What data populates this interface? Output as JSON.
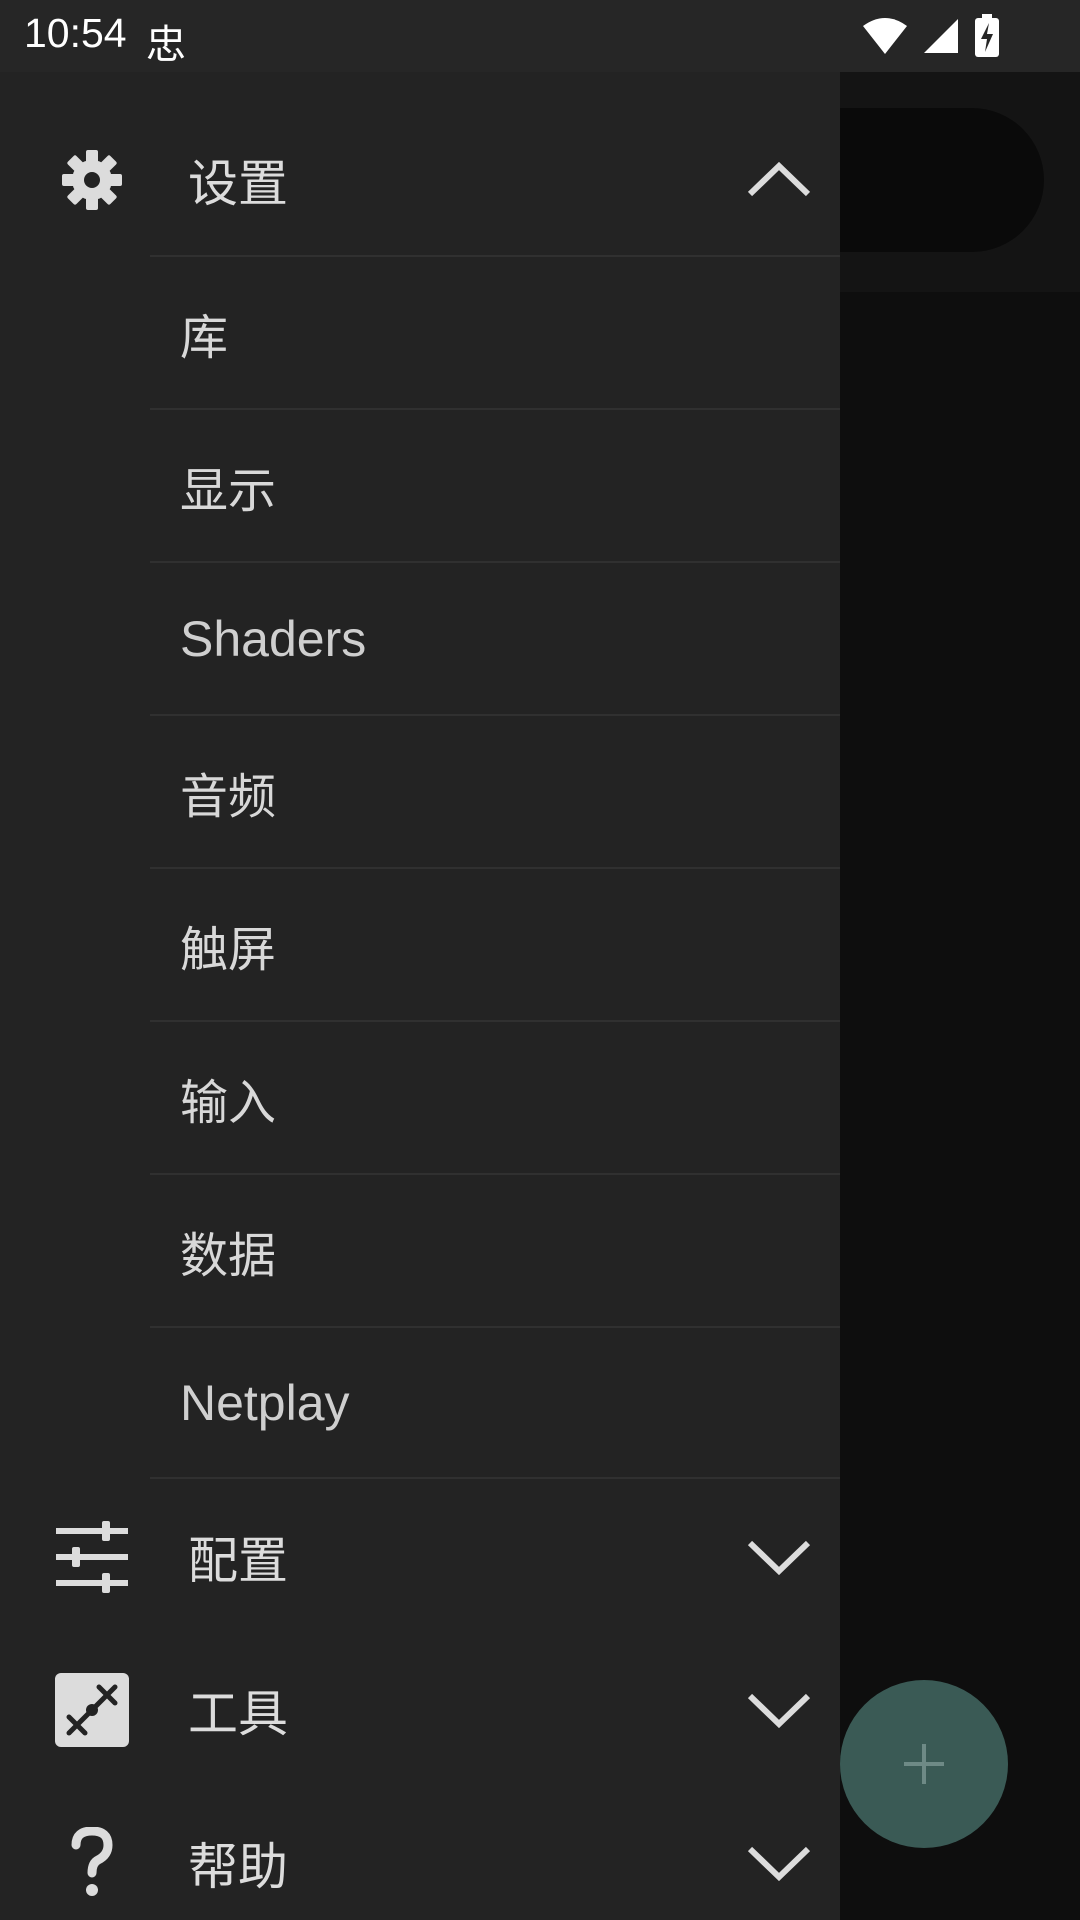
{
  "status_bar": {
    "time": "10:54",
    "app_icon_glyph": "忠",
    "icons": [
      "wifi-icon",
      "signal-icon",
      "battery-charging-icon"
    ]
  },
  "drawer": {
    "settings": {
      "label": "设置",
      "icon": "gear-icon",
      "expanded": true,
      "items": [
        {
          "label": "库"
        },
        {
          "label": "显示"
        },
        {
          "label": "Shaders"
        },
        {
          "label": "音频"
        },
        {
          "label": "触屏"
        },
        {
          "label": "输入"
        },
        {
          "label": "数据"
        },
        {
          "label": "Netplay"
        }
      ]
    },
    "profiles": {
      "label": "配置",
      "icon": "sliders-icon",
      "expanded": false
    },
    "tools": {
      "label": "工具",
      "icon": "tools-icon",
      "expanded": false
    },
    "help": {
      "label": "帮助",
      "icon": "question-icon",
      "expanded": false
    }
  },
  "fab": {
    "icon": "plus-icon"
  },
  "colors": {
    "drawer_bg": "#232323",
    "text": "#dcdcdc",
    "divider": "#303030",
    "fab": "#3a5a55"
  }
}
